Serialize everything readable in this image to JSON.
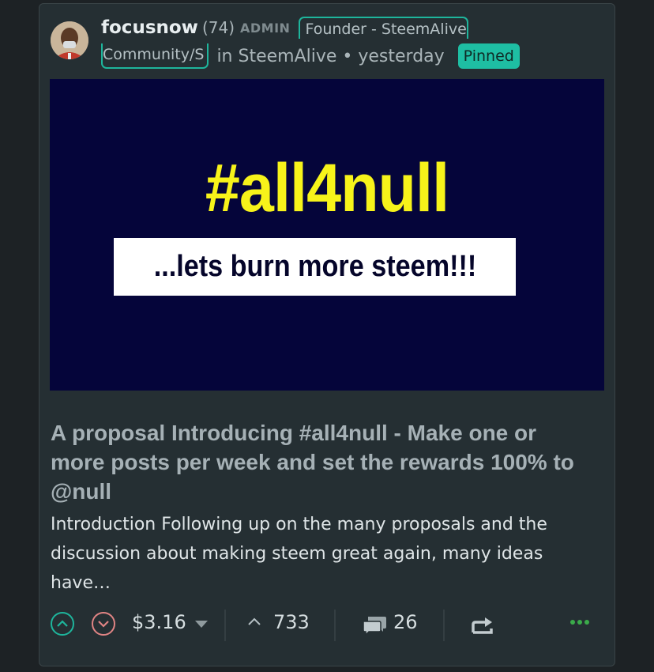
{
  "post": {
    "author": "focusnow",
    "reputation": "(74)",
    "role": "ADMIN",
    "title_part1": "Founder - SteemAlive",
    "title_part2": "Community/S",
    "community": "in SteemAlive • yesterday",
    "pinned": "Pinned",
    "banner": {
      "hashtag": "#all4null",
      "subtitle": "...lets burn more steem!!!"
    },
    "headline": "A proposal Introducing #all4null - Make one or more posts per week and set the rewards 100% to @null",
    "excerpt": "Introduction Following up on the many proposals and the discussion about making steem great again, many ideas have…",
    "payout": "$3.16",
    "votes": "733",
    "comments": "26"
  },
  "colors": {
    "accent": "#1eb59c",
    "downvote": "#e08484",
    "banner_bg": "#05053a",
    "banner_text": "#f7f31a"
  },
  "icons": [
    "upvote-icon",
    "downvote-icon",
    "caret-down-icon",
    "votes-chevron-icon",
    "comments-icon",
    "reblog-icon",
    "more-icon"
  ]
}
